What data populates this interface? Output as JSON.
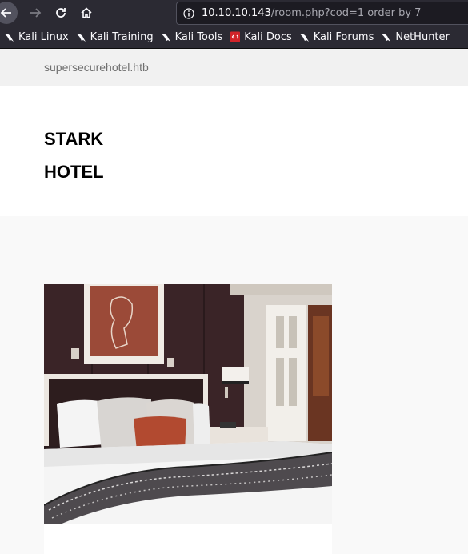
{
  "browser": {
    "url_host": "10.10.10.143",
    "url_path": "/room.php?cod=1 order by 7",
    "bookmarks": [
      {
        "label": "Kali Linux",
        "icon": "kali-dragon-icon"
      },
      {
        "label": "Kali Training",
        "icon": "kali-dragon-icon"
      },
      {
        "label": "Kali Tools",
        "icon": "kali-dragon-icon"
      },
      {
        "label": "Kali Docs",
        "icon": "kali-docs-icon"
      },
      {
        "label": "Kali Forums",
        "icon": "kali-dragon-icon"
      },
      {
        "label": "NetHunter",
        "icon": "kali-dragon-icon"
      }
    ]
  },
  "site": {
    "domain": "supersecurehotel.htb",
    "title": "STARK HOTEL"
  },
  "colors": {
    "chrome": "#2b2a33",
    "urlbar": "#1c1b22",
    "topbar": "#f1f1f1",
    "header": "#ffffff",
    "content": "#f9f9f9",
    "accent_pillow": "#b24a30"
  }
}
